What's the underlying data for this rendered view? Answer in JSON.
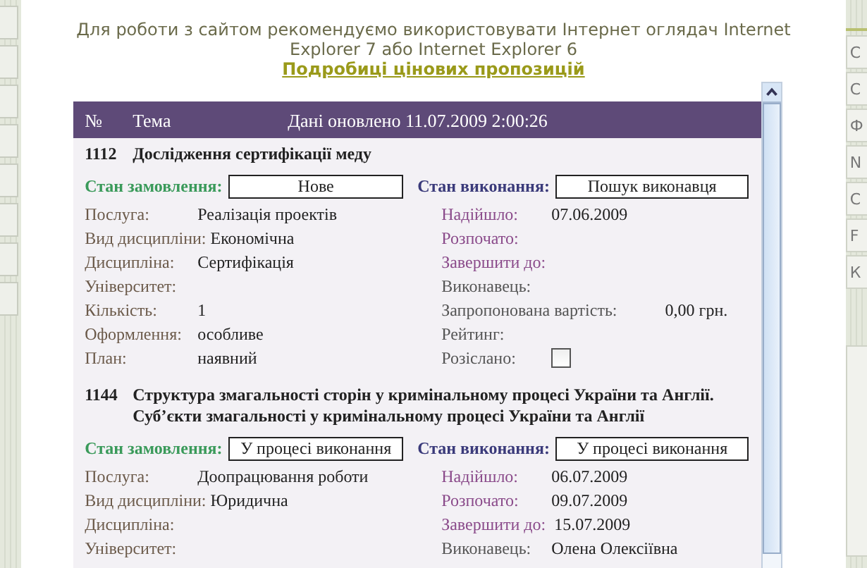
{
  "notice": {
    "text": "Для роботи з сайтом рекомендуємо використовувати Інтернет оглядач Internet Explorer 7 або Internet Explorer 6",
    "link": "Подробиці цінових пропозицій"
  },
  "table_header": {
    "number": "№",
    "topic": "Тема",
    "updated": "Дані оновлено 11.07.2009 2:00:26"
  },
  "orders": [
    {
      "number": "1112",
      "title": "Дослідження сертифікації меду",
      "order_status_label": "Стан замовлення:",
      "order_status": "Нове",
      "execution_status_label": "Стан виконання:",
      "execution_status": "Пошук виконавця",
      "left_fields": [
        {
          "label": "Послуга:",
          "value": "Реалізація проектів"
        },
        {
          "label": "Вид дисципліни:",
          "value": "Економічна"
        },
        {
          "label": "Дисципліна:",
          "value": "Сертифікація"
        },
        {
          "label": "Університет:"
        },
        {
          "label": "Кількість:",
          "value": "1"
        },
        {
          "label": "Оформлення:",
          "value": "особливе"
        },
        {
          "label": "План:",
          "value": "наявний"
        }
      ],
      "right_fields": [
        {
          "kind": "date",
          "label": "Надійшло:",
          "value": "07.06.2009"
        },
        {
          "kind": "date",
          "label": "Розпочато:"
        },
        {
          "kind": "date",
          "label": "Завершити до:"
        },
        {
          "kind": "info",
          "label": "Виконавець:"
        },
        {
          "kind": "info",
          "label": "Запропонована вартість:",
          "value": "0,00 грн."
        },
        {
          "kind": "info",
          "label": "Рейтинг:"
        },
        {
          "kind": "checkbox",
          "label": "Розіслано:",
          "checked": false
        }
      ]
    },
    {
      "number": "1144",
      "title": "Структура змагальності сторін у кримінальному процесі України та Англії. Суб’єкти змагальності у кримінальному процесі України та Англії",
      "order_status_label": "Стан замовлення:",
      "order_status": "У процесі виконання",
      "execution_status_label": "Стан виконання:",
      "execution_status": "У процесі виконання",
      "left_fields": [
        {
          "label": "Послуга:",
          "value": "Доопрацювання роботи"
        },
        {
          "label": "Вид дисципліни:",
          "value": "Юридична"
        },
        {
          "label": "Дисципліна:"
        },
        {
          "label": "Університет:"
        }
      ],
      "right_fields": [
        {
          "kind": "date",
          "label": "Надійшло:",
          "value": "06.07.2009"
        },
        {
          "kind": "date",
          "label": "Розпочато:",
          "value": "09.07.2009"
        },
        {
          "kind": "date",
          "label": "Завершити до:",
          "value": "15.07.2009"
        },
        {
          "kind": "info",
          "label": "Виконавець:",
          "value": "Олена Олексіївна"
        }
      ]
    }
  ],
  "sidebar": {
    "items": [
      {
        "label": "С"
      },
      {
        "label": "С"
      },
      {
        "label": "Ф"
      },
      {
        "label": "N"
      },
      {
        "label": "С"
      },
      {
        "label": "F"
      },
      {
        "label": "К"
      }
    ]
  }
}
